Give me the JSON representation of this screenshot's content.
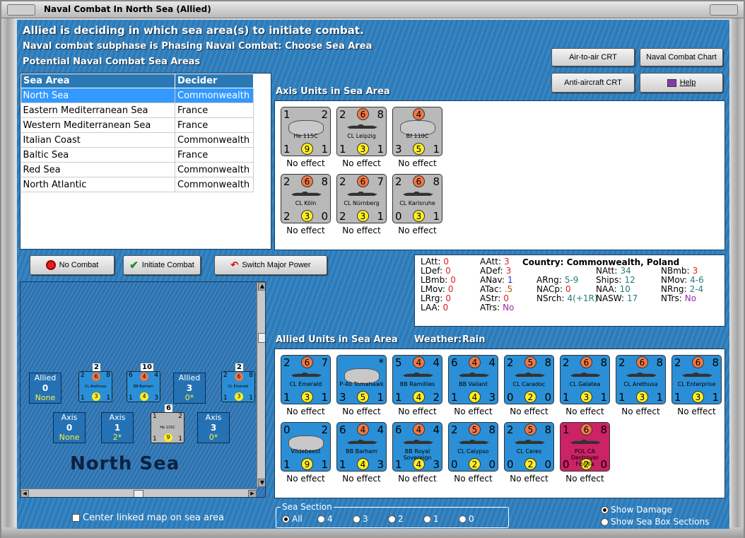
{
  "window": {
    "title": "Naval Combat In North Sea (Allied)"
  },
  "header": {
    "line1": "Allied is deciding in which sea area(s) to initiate combat.",
    "line2": "Naval combat subphase is Phasing Naval Combat: Choose Sea Area",
    "line3": "Potential Naval Combat Sea Areas"
  },
  "buttons": {
    "air_to_air": "Air-to-air CRT",
    "naval_chart": "Naval Combat Chart",
    "anti_aircraft": "Anti-aircraft CRT",
    "help": "Help",
    "no_combat": "No Combat",
    "initiate_combat": "Initiate Combat",
    "switch_major": "Switch Major Power"
  },
  "sea_table": {
    "headers": [
      "Sea Area",
      "Decider"
    ],
    "rows": [
      [
        "North Sea",
        "Commonwealth"
      ],
      [
        "Eastern Mediterranean Sea",
        "France"
      ],
      [
        "Western Mediterranean Sea",
        "France"
      ],
      [
        "Italian Coast",
        "Commonwealth"
      ],
      [
        "Baltic Sea",
        "France"
      ],
      [
        "Red Sea",
        "Commonwealth"
      ],
      [
        "North Atlantic",
        "Commonwealth"
      ]
    ]
  },
  "axis": {
    "label": "Axis Units in Sea Area",
    "units": [
      {
        "type": "plane",
        "tl": "1",
        "tr": "2",
        "bl": "1",
        "br": "1",
        "top": "",
        "bot": "9",
        "name": "He 115C",
        "effect": "No effect"
      },
      {
        "type": "ship",
        "tl": "2",
        "tr": "8",
        "bl": "1",
        "br": "1",
        "top": "6",
        "bot": "3",
        "name": "CL Leipzig",
        "effect": "No effect"
      },
      {
        "type": "plane",
        "tl": "",
        "tr": "",
        "bl": "3",
        "br": "1",
        "top": "4",
        "bot": "5",
        "name": "Bf 110C",
        "effect": "No effect"
      },
      {
        "type": "ship",
        "tl": "2",
        "tr": "8",
        "bl": "2",
        "br": "0",
        "top": "6",
        "bot": "3",
        "name": "CL Köln",
        "effect": "No effect"
      },
      {
        "type": "ship",
        "tl": "2",
        "tr": "7",
        "bl": "2",
        "br": "1",
        "top": "6",
        "bot": "3",
        "name": "CL Nürnberg",
        "effect": "No effect"
      },
      {
        "type": "ship",
        "tl": "2",
        "tr": "8",
        "bl": "0",
        "br": "1",
        "top": "6",
        "bot": "3",
        "name": "CL Karlsruhe",
        "effect": "No effect"
      }
    ]
  },
  "country": {
    "title": "Country: Commonwealth, Poland",
    "col1": [
      [
        "LAtt:",
        "0"
      ],
      [
        "LDef:",
        "0"
      ],
      [
        "LBmb:",
        "0"
      ],
      [
        "LMov:",
        "0"
      ],
      [
        "LRrg:",
        "0"
      ],
      [
        "LAA:",
        "0"
      ]
    ],
    "col2": [
      [
        "AAtt:",
        "3"
      ],
      [
        "ADef:",
        "3"
      ],
      [
        "ANav:",
        "1"
      ],
      [
        "ATac:",
        ".5"
      ],
      [
        "AStr:",
        "0"
      ],
      [
        "ATrs:",
        "No"
      ]
    ],
    "col3": [
      [
        "ARng:",
        "5-9"
      ],
      [
        "NACp:",
        "0"
      ],
      [
        "NSrch:",
        "4(+1R)"
      ]
    ],
    "col4": [
      [
        "NAtt:",
        "34"
      ],
      [
        "Ships:",
        "12"
      ],
      [
        "NAA:",
        "10"
      ],
      [
        "NASW:",
        "17"
      ]
    ],
    "col5": [
      [
        "NBmb:",
        "3"
      ],
      [
        "NMov:",
        "4-6"
      ],
      [
        "NRng:",
        "2-4"
      ],
      [
        "NTrs:",
        "No"
      ]
    ]
  },
  "allied": {
    "label": "Allied Units in Sea Area",
    "weather_label": "Weather:",
    "weather": "Rain",
    "units": [
      {
        "type": "ship",
        "color": "blue",
        "tl": "2",
        "tr": "7",
        "bl": "1",
        "br": "1",
        "top": "6",
        "bot": "3",
        "name": "CL Emerald",
        "effect": "No effect"
      },
      {
        "type": "plane",
        "color": "blue",
        "tl": "",
        "tr": "*",
        "bl": "3",
        "br": "1",
        "top": "",
        "bot": "5",
        "name": "P-40 Tomahawk",
        "effect": "No effect"
      },
      {
        "type": "ship",
        "color": "blue",
        "tl": "5",
        "tr": "4",
        "bl": "1",
        "br": "2",
        "top": "4",
        "bot": "4",
        "name": "BB Ramillies",
        "effect": "No effect"
      },
      {
        "type": "ship",
        "color": "blue",
        "tl": "6",
        "tr": "4",
        "bl": "1",
        "br": "3",
        "top": "4",
        "bot": "4",
        "name": "BB Valiant",
        "effect": "No effect"
      },
      {
        "type": "ship",
        "color": "blue",
        "tl": "2",
        "tr": "8",
        "bl": "0",
        "br": "0",
        "top": "5",
        "bot": "2",
        "name": "CL Caradoc",
        "effect": "No effect"
      },
      {
        "type": "ship",
        "color": "blue",
        "tl": "2",
        "tr": "8",
        "bl": "1",
        "br": "1",
        "top": "6",
        "bot": "3",
        "name": "CL Galatea",
        "effect": "No effect"
      },
      {
        "type": "ship",
        "color": "blue",
        "tl": "2",
        "tr": "8",
        "bl": "1",
        "br": "1",
        "top": "6",
        "bot": "3",
        "name": "CL Arethusa",
        "effect": "No effect"
      },
      {
        "type": "ship",
        "color": "blue",
        "tl": "2",
        "tr": "8",
        "bl": "1",
        "br": "1",
        "top": "6",
        "bot": "3",
        "name": "CL Enterprise",
        "effect": "No effect"
      },
      {
        "type": "plane",
        "color": "blue",
        "tl": "0",
        "tr": "2",
        "bl": "1",
        "br": "1",
        "top": "",
        "bot": "9",
        "name": "Vildebeest",
        "effect": "No effect"
      },
      {
        "type": "ship",
        "color": "blue",
        "tl": "6",
        "tr": "4",
        "bl": "1",
        "br": "3",
        "top": "4",
        "bot": "4",
        "name": "BB Barham",
        "effect": "No effect"
      },
      {
        "type": "ship",
        "color": "blue",
        "tl": "6",
        "tr": "4",
        "bl": "1",
        "br": "3",
        "top": "4",
        "bot": "4",
        "name": "BB Royal Sovereign",
        "effect": "No effect"
      },
      {
        "type": "ship",
        "color": "blue",
        "tl": "2",
        "tr": "8",
        "bl": "0",
        "br": "0",
        "top": "5",
        "bot": "2",
        "name": "CL Calypso",
        "effect": "No effect"
      },
      {
        "type": "ship",
        "color": "blue",
        "tl": "2",
        "tr": "8",
        "bl": "0",
        "br": "0",
        "top": "5",
        "bot": "2",
        "name": "CL Ceres",
        "effect": "No effect"
      },
      {
        "type": "ship",
        "color": "pink",
        "tl": "1",
        "tr": "8",
        "bl": "0",
        "br": "0",
        "top": "6",
        "bot": "2",
        "name": "POL CA Destroyer Flotilla",
        "effect": "No effect"
      }
    ]
  },
  "map": {
    "name": "North Sea",
    "allied_boxes": [
      {
        "label": "Allied",
        "value": "0",
        "sub": "None"
      },
      {
        "label": "Allied",
        "value": "3",
        "sub": "0*"
      }
    ],
    "axis_boxes": [
      {
        "label": "Axis",
        "value": "0",
        "sub": "None"
      },
      {
        "label": "Axis",
        "value": "1",
        "sub": "2*"
      },
      {
        "label": "Axis",
        "value": "3",
        "sub": "0*"
      }
    ],
    "minis": [
      {
        "color": "blue",
        "tl": "2",
        "tr": "8",
        "bl": "1",
        "br": "1",
        "top": "6",
        "bot": "3",
        "name": "CL Arethusa",
        "stack": "2"
      },
      {
        "color": "blue",
        "tl": "6",
        "tr": "4",
        "bl": "1",
        "br": "3",
        "top": "4",
        "bot": "4",
        "name": "BB Barham",
        "stack": "10"
      },
      {
        "color": "blue",
        "tl": "2",
        "tr": "8",
        "bl": "1",
        "br": "1",
        "top": "6",
        "bot": "3",
        "name": "CL Emerald",
        "stack": "2"
      },
      {
        "color": "grey",
        "tl": "1",
        "tr": "2",
        "bl": "1",
        "br": "1",
        "top": "",
        "bot": "9",
        "name": "He 115C",
        "stack": "6"
      }
    ],
    "center_label": "Center linked map on sea area"
  },
  "sea_section": {
    "label": "Sea Section",
    "options": [
      "All",
      "4",
      "3",
      "2",
      "1",
      "0"
    ],
    "selected": "All"
  },
  "display_options": {
    "show_damage": "Show Damage",
    "show_sea_box": "Show Sea Box Sections"
  },
  "colors": {
    "accent": "#2e7fbf",
    "selected_row": "#3399ff",
    "topcircle": "#f07845",
    "botcircle": "#ffee22",
    "pink": "#cc2266"
  }
}
